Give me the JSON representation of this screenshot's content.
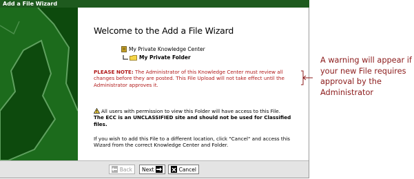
{
  "window": {
    "title": "Add a File Wizard"
  },
  "wizard": {
    "heading": "Welcome to the Add a File Wizard",
    "tree": {
      "root": "My Private Knowledge Center",
      "child": "My Private Folder"
    },
    "note": {
      "label": "PLEASE NOTE:",
      "text": " The Administrator of this Knowledge Center must review all changes before they are posted.  This File Upload will not take effect until the Administrator approves it."
    },
    "access_text": "All users with permission to view this Folder will have access to this File.",
    "ecc_text": "The ECC is an UNCLASSIFIED site and should not be used for Classified files.",
    "different_location_text": "If you wish to add this File to a different location, click \"Cancel\" and access this Wizard from the correct Knowledge Center and Folder."
  },
  "footer": {
    "back_label": "Back",
    "next_label": "Next",
    "cancel_label": "Cancel"
  },
  "callout": {
    "text": "A warning will appear if your new File requires approval by the Administrator"
  },
  "colors": {
    "titlebar": "#1e5a1e",
    "sidebar": "#0d4a0d",
    "warning_text": "#b01818",
    "callout_text": "#8b1a1a"
  },
  "icons": {
    "knowledge_center": "knowledge-center-icon",
    "folder": "folder-icon",
    "warning": "warning-icon",
    "back": "left-arrow-icon",
    "next": "right-arrow-icon",
    "cancel": "x-icon"
  }
}
